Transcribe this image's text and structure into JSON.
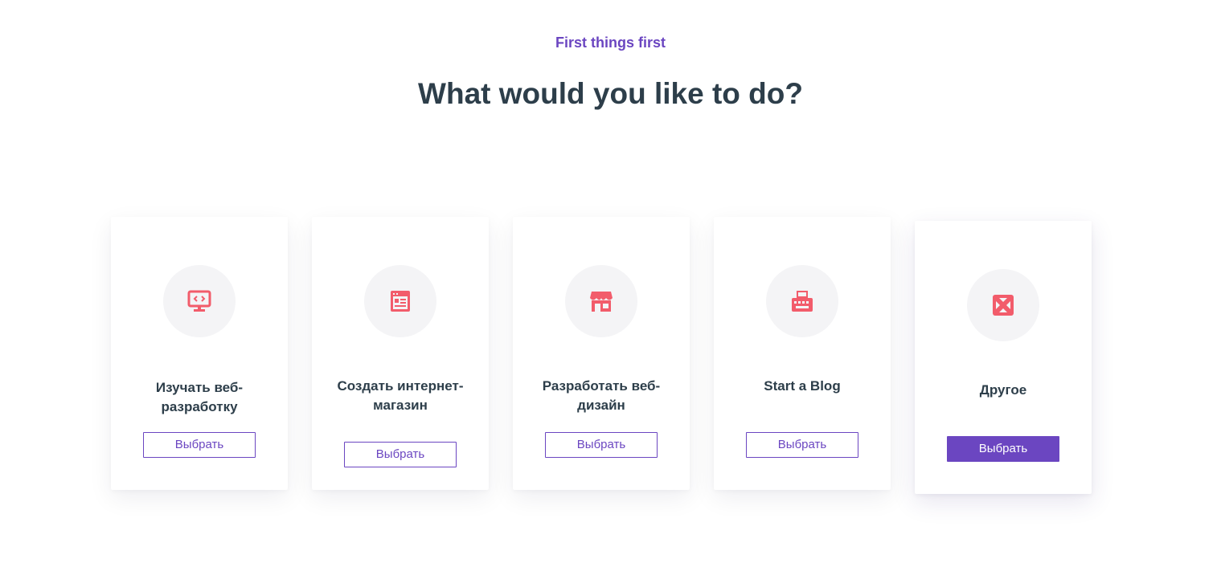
{
  "header": {
    "eyebrow": "First things first",
    "title": "What would you like to do?"
  },
  "colors": {
    "accent": "#6b46c1",
    "icon": "#f25c6b",
    "heading": "#2d3e4a"
  },
  "cards": [
    {
      "icon": "monitor-code-icon",
      "label": "Изучать веб-разработку",
      "button": "Выбрать",
      "selected": false
    },
    {
      "icon": "browser-window-icon",
      "label": "Создать интернет-магазин",
      "button": "Выбрать",
      "selected": false
    },
    {
      "icon": "storefront-icon",
      "label": "Разработать веб-дизайн",
      "button": "Выбрать",
      "selected": false
    },
    {
      "icon": "typewriter-icon",
      "label": "Start a Blog",
      "button": "Выбрать",
      "selected": false
    },
    {
      "icon": "lifebuoy-icon",
      "label": "Другое",
      "button": "Выбрать",
      "selected": true
    }
  ]
}
